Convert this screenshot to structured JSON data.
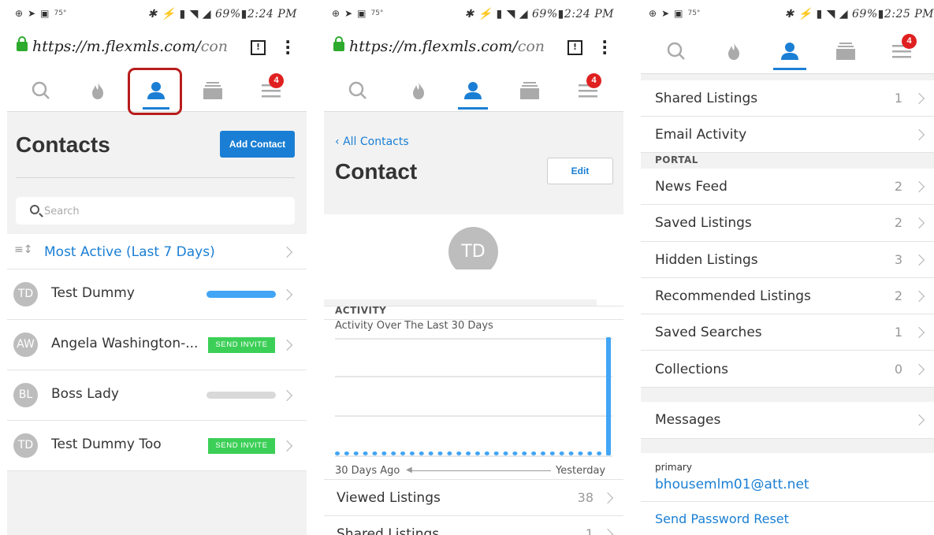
{
  "status_left_temp": "75°",
  "panel1": {
    "status_time": "✱ ⚡ ▮ ◥ ◢ 69%▮2:24 PM",
    "url_main": "https://m.flexmls.com/",
    "url_dim": "con",
    "badge_count": "4",
    "title": "Contacts",
    "add_contact": "Add Contact",
    "search_placeholder": "Search",
    "sort_label": "Most Active (Last 7 Days)",
    "contacts": [
      {
        "initials": "TD",
        "name": "Test Dummy",
        "status": "bar",
        "activity": 1.0,
        "color": "#42a5f5"
      },
      {
        "initials": "AW",
        "name": "Angela Washington-...",
        "status": "invite",
        "invite_label": "SEND INVITE"
      },
      {
        "initials": "BL",
        "name": "Boss Lady",
        "status": "bar",
        "activity": 1.0,
        "color": "#d9d9d9"
      },
      {
        "initials": "TD",
        "name": "Test Dummy Too",
        "status": "invite",
        "invite_label": "SEND INVITE"
      }
    ]
  },
  "panel2": {
    "status_time": "✱ ⚡ ▮ ◥ ◢ 69%▮2:24 PM",
    "url_main": "https://m.flexmls.com/",
    "url_dim": "con",
    "badge_count": "4",
    "back_link": "All Contacts",
    "title": "Contact",
    "edit_label": "Edit",
    "avatar_initials": "TD",
    "activity_heading": "ACTIVITY",
    "activity_sub": "Activity Over The Last 30 Days",
    "axis_left": "30 Days Ago",
    "axis_right": "Yesterday",
    "rows": [
      {
        "label": "Viewed Listings",
        "count": "38"
      },
      {
        "label": "Shared Listings",
        "count": "1"
      }
    ]
  },
  "chart_data": {
    "type": "bar",
    "title": "Activity Over The Last 30 Days",
    "xlabel": "",
    "ylabel": "",
    "x_range_labels": [
      "30 Days Ago",
      "Yesterday"
    ],
    "values": [
      0,
      0,
      0,
      0,
      0,
      0,
      0,
      0,
      0,
      0,
      0,
      0,
      0,
      0,
      0,
      0,
      0,
      0,
      0,
      0,
      0,
      0,
      0,
      0,
      0,
      0,
      0,
      0,
      0,
      38
    ],
    "ylim": [
      0,
      40
    ],
    "grid": true,
    "color": "#42a5f5"
  },
  "panel3": {
    "status_time": "✱ ⚡ ▮ ◥ ◢ 69%▮2:25 PM",
    "badge_count": "4",
    "rows_top": [
      {
        "label": "Shared Listings",
        "count": "1"
      },
      {
        "label": "Email Activity",
        "count": ""
      }
    ],
    "portal_heading": "PORTAL",
    "rows_portal": [
      {
        "label": "News Feed",
        "count": "2"
      },
      {
        "label": "Saved Listings",
        "count": "2"
      },
      {
        "label": "Hidden Listings",
        "count": "3"
      },
      {
        "label": "Recommended Listings",
        "count": "2"
      },
      {
        "label": "Saved Searches",
        "count": "1"
      },
      {
        "label": "Collections",
        "count": "0"
      }
    ],
    "messages_label": "Messages",
    "email_type": "primary",
    "email": "bhousemlm01@att.net",
    "reset_link": "Send Password Reset"
  }
}
